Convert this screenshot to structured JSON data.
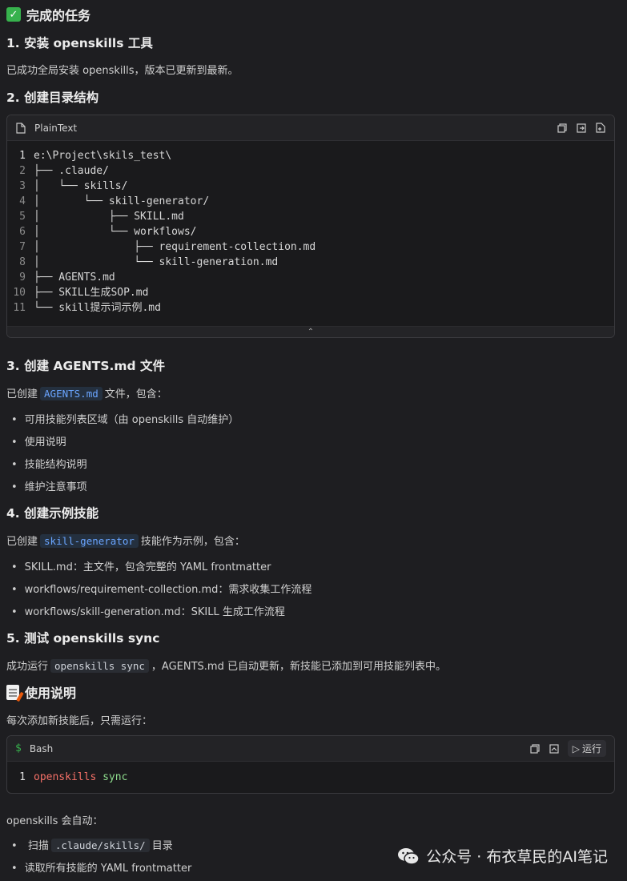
{
  "header": {
    "title": "完成的任务"
  },
  "sections": [
    {
      "title": "1. 安装 openskills 工具",
      "text": "已成功全局安装 openskills，版本已更新到最新。"
    },
    {
      "title": "2. 创建目录结构"
    },
    {
      "title": "3. 创建 AGENTS.md 文件",
      "prefix": "已创建",
      "code": "AGENTS.md",
      "suffix": "文件，包含：",
      "bullets": [
        "可用技能列表区域（由 openskills 自动维护）",
        "使用说明",
        "技能结构说明",
        "维护注意事项"
      ]
    },
    {
      "title": "4. 创建示例技能",
      "prefix": "已创建",
      "code": "skill-generator",
      "suffix": "技能作为示例，包含：",
      "bullets": [
        "SKILL.md：主文件，包含完整的 YAML frontmatter",
        "workflows/requirement-collection.md：需求收集工作流程",
        "workflows/skill-generation.md：SKILL 生成工作流程"
      ]
    },
    {
      "title": "5. 测试 openskills sync",
      "prefix": "成功运行",
      "code": "openskills sync",
      "suffix": "，AGENTS.md 已自动更新，新技能已添加到可用技能列表中。"
    }
  ],
  "tree_block": {
    "lang": "PlainText",
    "lines": [
      "e:\\Project\\skils_test\\",
      "├── .claude/",
      "│   └── skills/",
      "│       └── skill-generator/",
      "│           ├── SKILL.md",
      "│           └── workflows/",
      "│               ├── requirement-collection.md",
      "│               └── skill-generation.md",
      "├── AGENTS.md",
      "├── SKILL生成SOP.md",
      "└── skill提示词示例.md"
    ]
  },
  "usage": {
    "title": "使用说明",
    "intro": "每次添加新技能后，只需运行：",
    "block": {
      "lang": "Bash",
      "run_label": "运行",
      "cmd": "openskills",
      "arg": "sync"
    },
    "auto_text": "openskills 会自动：",
    "bullets": [
      {
        "prefix": "扫描",
        "code": ".claude/skills/",
        "suffix": "目录"
      },
      {
        "text": "读取所有技能的 YAML frontmatter"
      }
    ]
  },
  "watermark": "公众号 · 布衣草民的AI笔记",
  "colors": {
    "accent_blue": "#6aa5ff",
    "check_green": "#37b24d",
    "bash_red": "#f47067",
    "bash_green": "#8ddb8c"
  }
}
